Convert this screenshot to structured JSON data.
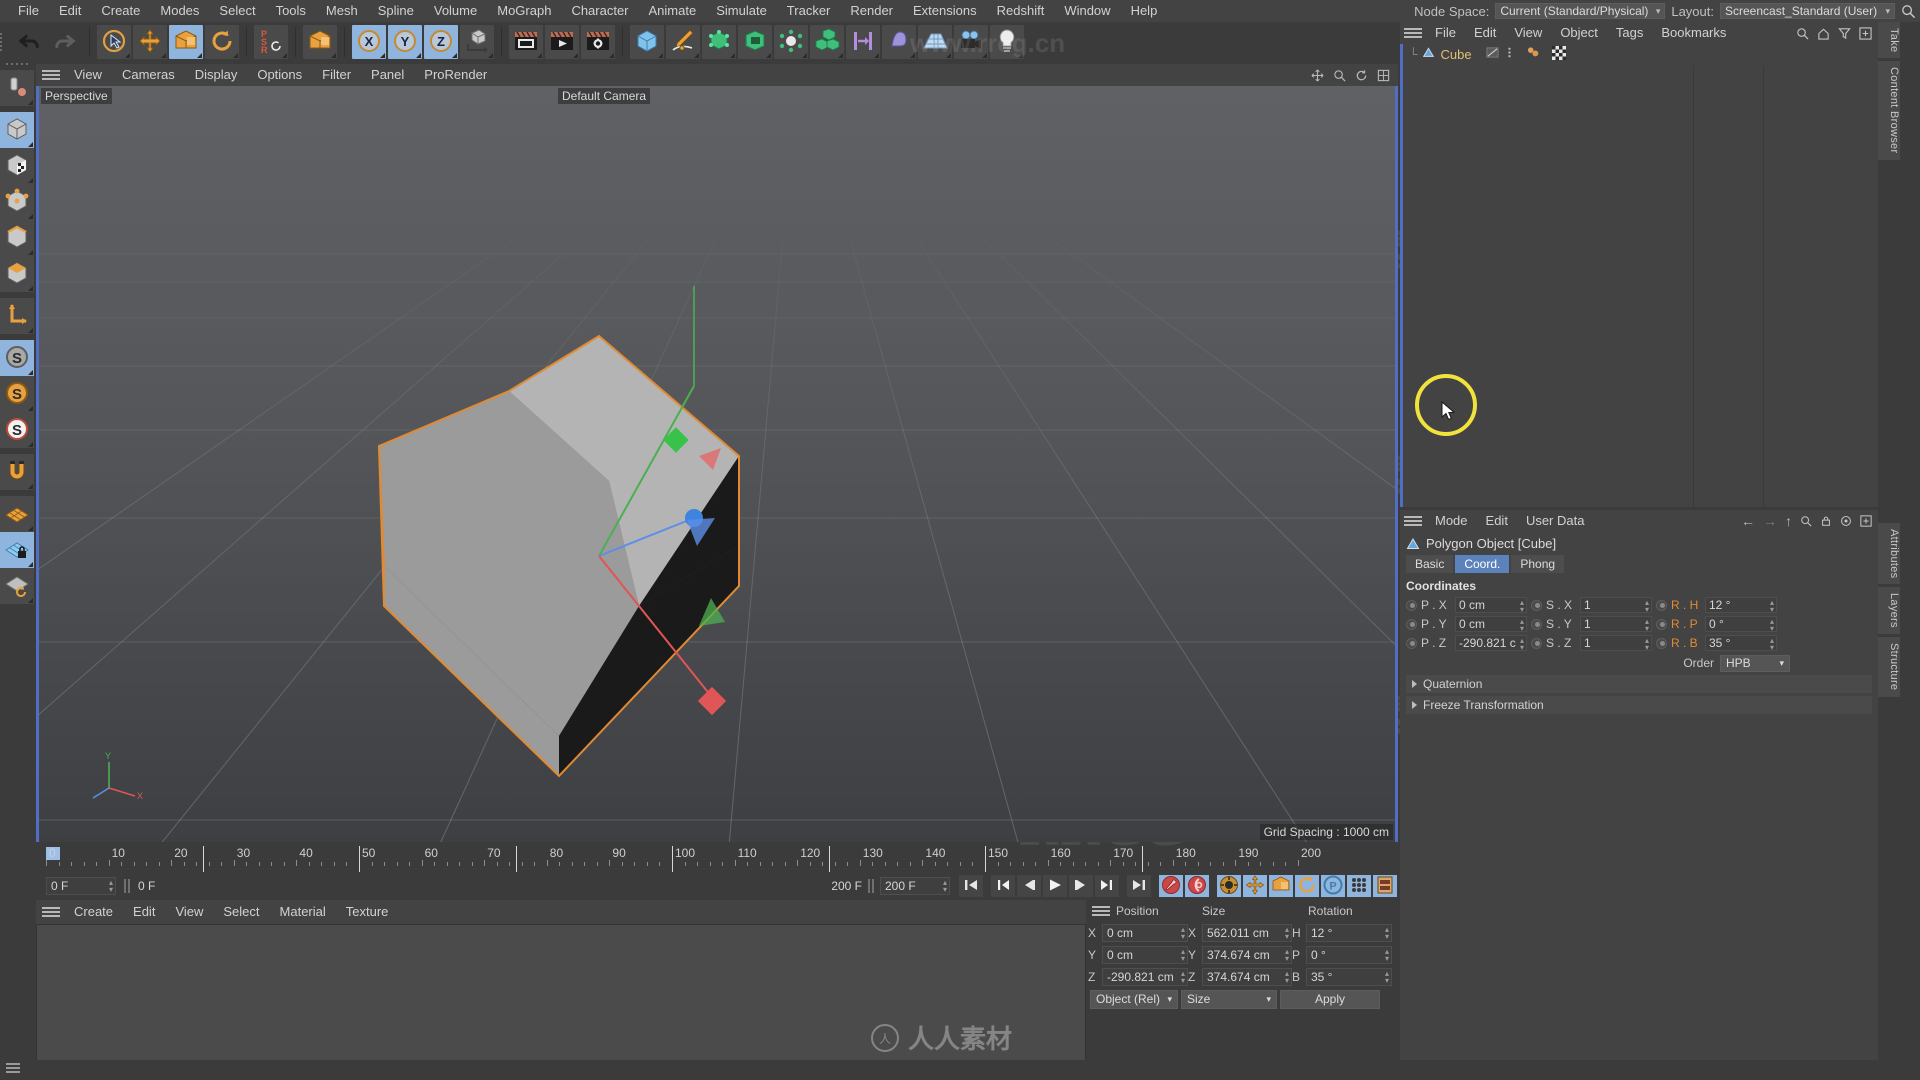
{
  "menubar": {
    "items": [
      "File",
      "Edit",
      "Create",
      "Modes",
      "Select",
      "Tools",
      "Mesh",
      "Spline",
      "Volume",
      "MoGraph",
      "Character",
      "Animate",
      "Simulate",
      "Tracker",
      "Render",
      "Extensions",
      "Redshift",
      "Window",
      "Help"
    ],
    "node_space_label": "Node Space:",
    "node_space_value": "Current (Standard/Physical)",
    "layout_label": "Layout:",
    "layout_value": "Screencast_Standard (User)",
    "search_icon": "search-icon"
  },
  "toolbar": {
    "groups": [
      {
        "name": "history",
        "buttons": [
          {
            "name": "undo-button",
            "icon": "undo-arrow-icon",
            "active": false
          },
          {
            "name": "redo-button",
            "icon": "redo-arrow-icon",
            "active": false
          }
        ]
      },
      {
        "name": "tools",
        "buttons": [
          {
            "name": "select-tool-button",
            "icon": "live-selection-icon",
            "active": false
          },
          {
            "name": "move-tool-button",
            "icon": "move-icon",
            "active": false
          },
          {
            "name": "scale-tool-button",
            "icon": "scale-icon",
            "active": true
          },
          {
            "name": "rotate-tool-button",
            "icon": "rotate-icon",
            "active": false
          }
        ]
      },
      {
        "name": "psr",
        "buttons": [
          {
            "name": "psr-toggle-button",
            "icon": "psr-icon",
            "active": false
          }
        ]
      },
      {
        "name": "modeling-axis",
        "buttons": [
          {
            "name": "modeling-axis-button",
            "icon": "axis-box-icon",
            "active": false
          }
        ]
      },
      {
        "name": "axis-locks",
        "buttons": [
          {
            "name": "lock-x-button",
            "icon": "x-axis-icon",
            "active": true
          },
          {
            "name": "lock-y-button",
            "icon": "y-axis-icon",
            "active": true
          },
          {
            "name": "lock-z-button",
            "icon": "z-axis-icon",
            "active": true
          },
          {
            "name": "world-object-button",
            "icon": "world-coord-icon",
            "active": false
          }
        ]
      },
      {
        "name": "render",
        "buttons": [
          {
            "name": "render-view-button",
            "icon": "render-view-icon",
            "active": false
          },
          {
            "name": "render-picture-button",
            "icon": "render-picture-icon",
            "active": false
          },
          {
            "name": "render-settings-button",
            "icon": "render-settings-icon",
            "active": false
          }
        ]
      },
      {
        "name": "creation",
        "buttons": [
          {
            "name": "add-cube-button",
            "icon": "cube-primitive-icon",
            "active": false
          },
          {
            "name": "add-spline-button",
            "icon": "pen-spline-icon",
            "active": false
          },
          {
            "name": "generator-button",
            "icon": "generator-icon",
            "active": false
          },
          {
            "name": "nurbs-button",
            "icon": "nurbs-icon",
            "active": false
          },
          {
            "name": "deformer-button",
            "icon": "deformer-icon",
            "active": false
          },
          {
            "name": "array-button",
            "icon": "array-icon",
            "active": false
          },
          {
            "name": "scene-button",
            "icon": "scene-icon",
            "active": false
          },
          {
            "name": "field-button",
            "icon": "field-icon",
            "active": false
          },
          {
            "name": "floor-button",
            "icon": "floor-grid-icon",
            "active": false
          },
          {
            "name": "camera-button",
            "icon": "camera-icon",
            "active": false
          },
          {
            "name": "light-button",
            "icon": "light-bulb-icon",
            "active": false
          }
        ]
      }
    ]
  },
  "leftbar": {
    "items": [
      {
        "name": "model-mode-button",
        "icon": "pointer-handle-icon",
        "active": false
      },
      {
        "name": "object-mode-button",
        "icon": "object-cube-icon",
        "active": true
      },
      {
        "name": "texture-mode-button",
        "icon": "texture-cube-icon",
        "active": false
      },
      {
        "name": "point-mode-button",
        "icon": "point-cube-icon",
        "active": false
      },
      {
        "name": "edge-mode-button",
        "icon": "edge-cube-icon",
        "active": false
      },
      {
        "name": "polygon-mode-button",
        "icon": "polygon-cube-icon",
        "active": false
      },
      {
        "name": "axis-mode-button",
        "icon": "axis-l-icon",
        "active": false
      },
      {
        "name": "enable-snap-button",
        "icon": "snap-s-icon",
        "active": true
      },
      {
        "name": "workplane-snap-button",
        "icon": "snap-s-orange-icon",
        "active": false
      },
      {
        "name": "quantize-button",
        "icon": "snap-s-white-icon",
        "active": false
      },
      {
        "name": "magnet-button",
        "icon": "magnet-icon",
        "active": false
      },
      {
        "name": "workplane-button",
        "icon": "workplane-grid-icon",
        "active": false
      },
      {
        "name": "lock-workplane-button",
        "icon": "workplane-lock-icon",
        "active": true
      },
      {
        "name": "align-workplane-button",
        "icon": "workplane-align-icon",
        "active": false
      }
    ]
  },
  "viewport": {
    "menu": [
      "View",
      "Cameras",
      "Display",
      "Options",
      "Filter",
      "Panel",
      "ProRender"
    ],
    "projection_label": "Perspective",
    "camera_label": "Default Camera",
    "grid_spacing": "Grid Spacing : 1000 cm",
    "axis_x_label": "X",
    "axis_y_label": "Y",
    "axis_z_label": "Z"
  },
  "timeline": {
    "ticks": [
      0,
      10,
      20,
      30,
      40,
      50,
      60,
      70,
      80,
      90,
      100,
      110,
      120,
      130,
      140,
      150,
      160,
      170,
      180,
      190,
      200
    ],
    "min_frame": "0 F",
    "current_frame": "0 F",
    "preview_max": "200 F",
    "max_frame": "200 F",
    "transport_buttons": [
      {
        "name": "go-to-start-button",
        "icon": "skip-start-icon"
      },
      {
        "name": "go-to-previous-key-button",
        "icon": "prev-key-icon"
      },
      {
        "name": "step-back-button",
        "icon": "step-back-icon"
      },
      {
        "name": "play-button",
        "icon": "play-icon"
      },
      {
        "name": "step-forward-button",
        "icon": "step-forward-icon"
      },
      {
        "name": "go-to-next-key-button",
        "icon": "next-key-icon"
      },
      {
        "name": "go-to-end-button",
        "icon": "skip-end-icon"
      },
      {
        "name": "record-keyframe-button",
        "icon": "record-key-icon"
      },
      {
        "name": "autokeying-button",
        "icon": "autokey-icon"
      },
      {
        "name": "keyframe-selection-button",
        "icon": "key-selection-icon"
      },
      {
        "name": "position-key-button",
        "icon": "position-key-icon"
      },
      {
        "name": "scale-key-button",
        "icon": "scale-key-icon"
      },
      {
        "name": "rotation-key-button",
        "icon": "rotation-key-icon"
      },
      {
        "name": "param-key-button",
        "icon": "param-key-icon"
      },
      {
        "name": "pla-key-button",
        "icon": "pla-key-icon"
      },
      {
        "name": "timeline-toggle-button",
        "icon": "timeline-icon"
      }
    ]
  },
  "material_manager": {
    "menu": [
      "Create",
      "Edit",
      "View",
      "Select",
      "Material",
      "Texture"
    ]
  },
  "coordinate_manager": {
    "columns": [
      "Position",
      "Size",
      "Rotation"
    ],
    "rows": [
      {
        "axis": "X",
        "position": "0 cm",
        "size": "562.011 cm",
        "rot_axis": "H",
        "rotation": "12 °"
      },
      {
        "axis": "Y",
        "position": "0 cm",
        "size": "374.674 cm",
        "rot_axis": "P",
        "rotation": "0 °"
      },
      {
        "axis": "Z",
        "position": "-290.821 cm",
        "size": "374.674 cm",
        "rot_axis": "B",
        "rotation": "35 °"
      }
    ],
    "coord_system": "Object (Rel)",
    "size_mode": "Size",
    "apply_label": "Apply"
  },
  "object_manager": {
    "menu": [
      "File",
      "Edit",
      "View",
      "Object",
      "Tags",
      "Bookmarks"
    ],
    "icons": [
      "search-icon",
      "home-icon",
      "filter-icon",
      "plus-icon"
    ],
    "objects": [
      {
        "name": "Cube",
        "icon": "polygon-object-icon",
        "tags": [
          "phong-tag",
          "dots-tag",
          "uvw-tag",
          "texture-tag"
        ]
      }
    ]
  },
  "attributes": {
    "menu": [
      "Mode",
      "Edit",
      "User Data"
    ],
    "icons": [
      "back-arrow-icon",
      "forward-arrow-icon",
      "up-arrow-icon",
      "search-icon",
      "lock-icon",
      "target-icon",
      "plus-icon"
    ],
    "object_title": "Polygon Object [Cube]",
    "tabs": [
      {
        "label": "Basic",
        "selected": false
      },
      {
        "label": "Coord.",
        "selected": true
      },
      {
        "label": "Phong",
        "selected": false
      }
    ],
    "section_title": "Coordinates",
    "rows": [
      {
        "p_label": "P . X",
        "p_value": "0 cm",
        "s_label": "S . X",
        "s_value": "1",
        "r_label": "R . H",
        "r_value": "12 °"
      },
      {
        "p_label": "P . Y",
        "p_value": "0 cm",
        "s_label": "S . Y",
        "s_value": "1",
        "r_label": "R . P",
        "r_value": "0 °"
      },
      {
        "p_label": "P . Z",
        "p_value": "-290.821 c",
        "s_label": "S . Z",
        "s_value": "1",
        "r_label": "R . B",
        "r_value": "35 °"
      }
    ],
    "order_label": "Order",
    "order_value": "HPB",
    "folds": [
      "Quaternion",
      "Freeze Transformation"
    ]
  },
  "side_tabs_top": [
    "Take",
    "Content Browser"
  ],
  "side_tabs_bottom": [
    "Attributes",
    "Layers",
    "Structure"
  ],
  "watermarks": {
    "rrcg": "RRCG",
    "chinese": "人人素材",
    "url": "www.rrcg.cn",
    "logo": "人人素材"
  },
  "colors": {
    "accent_blue": "#8fb4de",
    "viewport_border": "#4f6ec4",
    "highlight_yellow": "#f2e23c",
    "orange": "#e08a33",
    "panel_bg": "#3b3b3b",
    "field_bg": "#3f3f3f"
  }
}
